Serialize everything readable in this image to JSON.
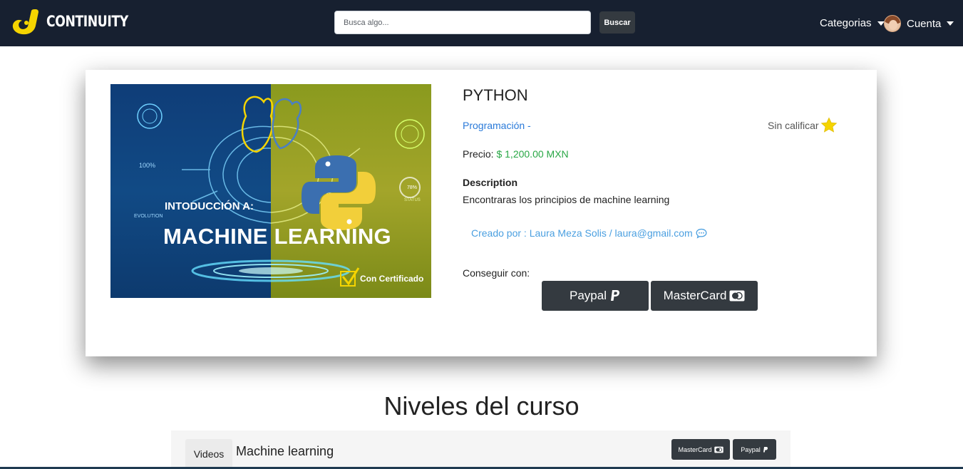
{
  "navbar": {
    "brand": "CONTINUITY",
    "search_placeholder": "Busca algo...",
    "search_button": "Buscar",
    "categories": "Categorias",
    "account": "Cuenta",
    "icons": [
      "continuity-logo",
      "chevron-down-icon",
      "avatar"
    ]
  },
  "course": {
    "banner": {
      "subtitle": "INTODUCCIÓN A:",
      "title": "MACHINE LEARNING",
      "certificate": "Con Certificado",
      "stat_100": "100%",
      "stat_78": "78%",
      "evolution": "EVOLUTION",
      "status": "STATUS"
    },
    "title": "PYTHON",
    "category": "Programación -",
    "rating": "Sin calificar",
    "price_label": "Precio:",
    "price_value": "$ 1,200.00 MXN",
    "description_heading": "Description",
    "description": "Encontraras los principios de machine learning",
    "creator": "Creado por : Laura Meza Solis / laura@gmail.com",
    "get_with": "Conseguir con:",
    "paypal_label": "Paypal",
    "mastercard_label": "MasterCard"
  },
  "levels": {
    "heading": "Niveles del curso",
    "tab": "Videos",
    "level_name": "Machine learning",
    "mastercard_label": "MasterCard",
    "paypal_label": "Paypal"
  },
  "colors": {
    "navbar": "#172030",
    "button": "#343a40",
    "link": "#2a7ad9",
    "price": "#28a745",
    "brand_yellow": "#f5d400"
  }
}
